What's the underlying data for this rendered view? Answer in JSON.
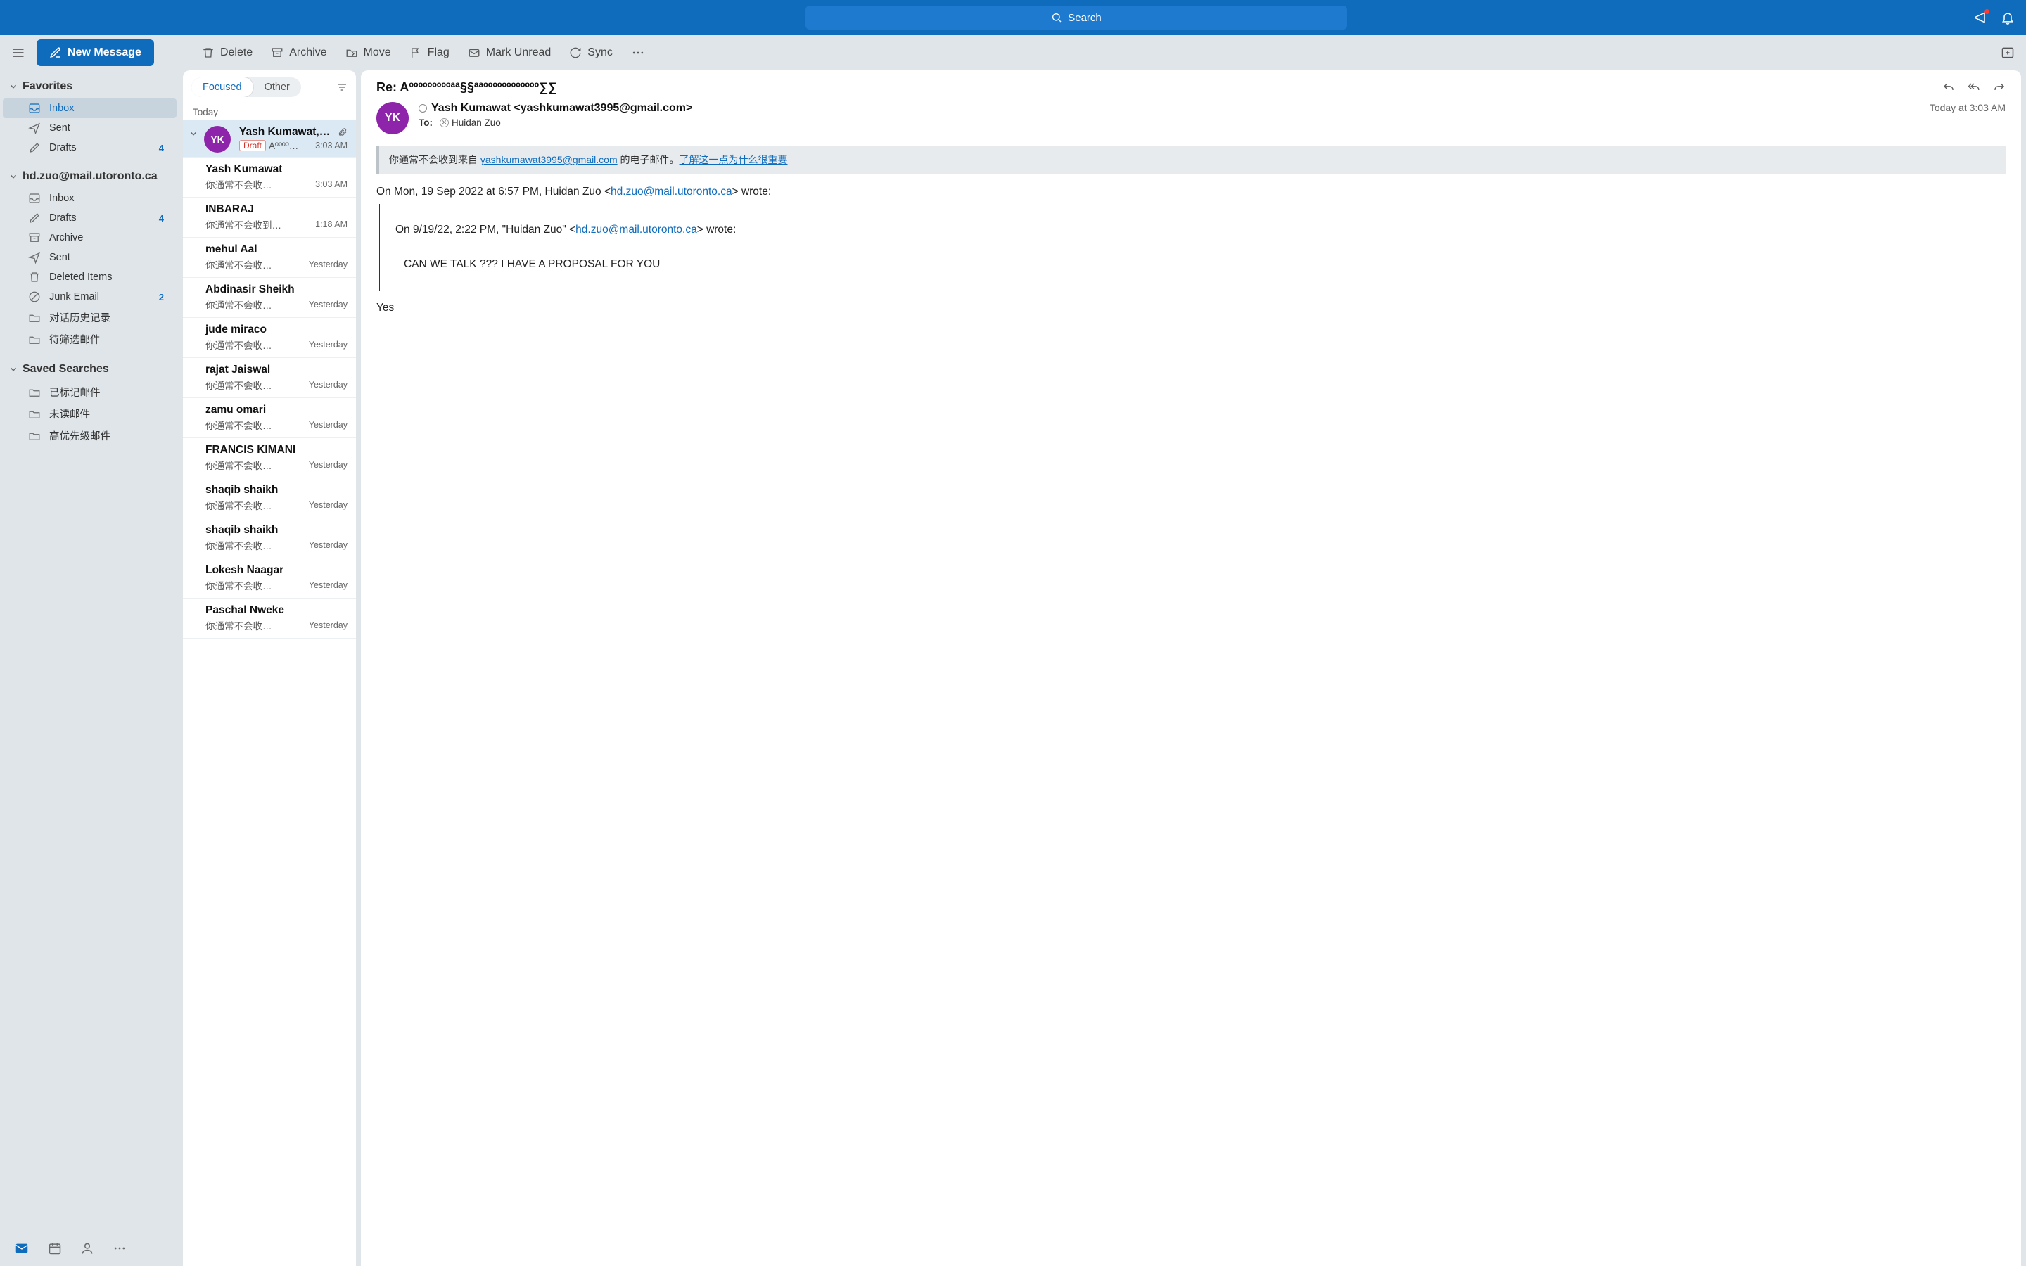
{
  "title_bar": {
    "search_placeholder": "Search"
  },
  "toolbar": {
    "new_message": "New Message",
    "delete": "Delete",
    "archive": "Archive",
    "move": "Move",
    "flag": "Flag",
    "mark_unread": "Mark Unread",
    "sync": "Sync"
  },
  "sidebar": {
    "favorites_label": "Favorites",
    "favorites": [
      {
        "label": "Inbox",
        "icon": "inbox",
        "selected": true
      },
      {
        "label": "Sent",
        "icon": "sent"
      },
      {
        "label": "Drafts",
        "icon": "drafts",
        "badge": "4"
      }
    ],
    "account_label": "hd.zuo@mail.utoronto.ca",
    "account_items": [
      {
        "label": "Inbox",
        "icon": "inbox"
      },
      {
        "label": "Drafts",
        "icon": "drafts",
        "badge": "4"
      },
      {
        "label": "Archive",
        "icon": "archive"
      },
      {
        "label": "Sent",
        "icon": "sent"
      },
      {
        "label": "Deleted Items",
        "icon": "trash"
      },
      {
        "label": "Junk Email",
        "icon": "junk",
        "badge": "2"
      },
      {
        "label": "对话历史记录",
        "icon": "folder"
      },
      {
        "label": "待筛选邮件",
        "icon": "folder"
      }
    ],
    "saved_label": "Saved Searches",
    "saved_items": [
      {
        "label": "已标记邮件",
        "icon": "folder"
      },
      {
        "label": "未读邮件",
        "icon": "folder"
      },
      {
        "label": "高优先级邮件",
        "icon": "folder"
      }
    ]
  },
  "message_list": {
    "tab_focused": "Focused",
    "tab_other": "Other",
    "group_label": "Today",
    "items": [
      {
        "from": "Yash Kumawat,…",
        "preview": "Aºººº…",
        "time": "3:03 AM",
        "draft": "Draft",
        "attachment": true,
        "avatar": "YK",
        "selected": true
      },
      {
        "from": "Yash Kumawat",
        "preview": "你通常不会收…",
        "time": "3:03 AM"
      },
      {
        "from": "INBARAJ",
        "preview": "你通常不会收到…",
        "time": "1:18 AM"
      },
      {
        "from": "mehul Aal",
        "preview": "你通常不会收…",
        "time": "Yesterday"
      },
      {
        "from": "Abdinasir Sheikh",
        "preview": "你通常不会收…",
        "time": "Yesterday"
      },
      {
        "from": "jude miraco",
        "preview": "你通常不会收…",
        "time": "Yesterday"
      },
      {
        "from": "rajat Jaiswal",
        "preview": "你通常不会收…",
        "time": "Yesterday"
      },
      {
        "from": "zamu omari",
        "preview": "你通常不会收…",
        "time": "Yesterday"
      },
      {
        "from": "FRANCIS KIMANI",
        "preview": "你通常不会收…",
        "time": "Yesterday"
      },
      {
        "from": "shaqib shaikh",
        "preview": "你通常不会收…",
        "time": "Yesterday"
      },
      {
        "from": "shaqib shaikh",
        "preview": "你通常不会收…",
        "time": "Yesterday"
      },
      {
        "from": "Lokesh Naagar",
        "preview": "你通常不会收…",
        "time": "Yesterday"
      },
      {
        "from": "Paschal Nweke",
        "preview": "你通常不会收…",
        "time": "Yesterday"
      }
    ]
  },
  "reader": {
    "subject": "Re: Aºººººººººªª§§ªªºººººººººººº∑∑",
    "avatar_initials": "YK",
    "sender": "Yash Kumawat <yashkumawat3995@gmail.com>",
    "to_label": "To:",
    "to_recipient": "Huidan Zuo",
    "date": "Today at 3:03 AM",
    "info_prefix": "你通常不会收到来自 ",
    "info_email": "yashkumawat3995@gmail.com",
    "info_suffix": " 的电子邮件。",
    "info_link": "了解这一点为什么很重要",
    "body_quote_intro_a": "On Mon, 19 Sep 2022 at 6:57 PM, Huidan Zuo <",
    "body_quote_link_a": "hd.zuo@mail.utoronto.ca",
    "body_quote_intro_b": "> wrote:",
    "body_inner_intro_a": "On 9/19/22, 2:22 PM, \"Huidan Zuo\" <",
    "body_inner_link": "hd.zuo@mail.utoronto.ca",
    "body_inner_intro_b": "> wrote:",
    "body_inner_text": "CAN WE TALK ??? I HAVE A PROPOSAL FOR YOU",
    "body_reply": "Yes"
  }
}
